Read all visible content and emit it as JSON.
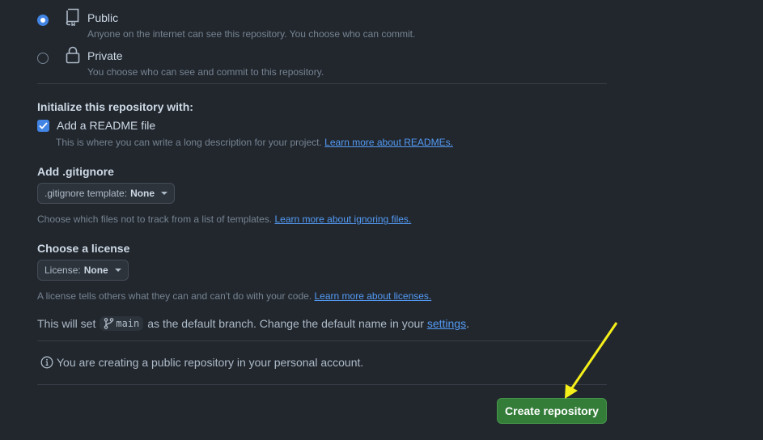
{
  "visibility": {
    "options": [
      {
        "title": "Public",
        "description": "Anyone on the internet can see this repository. You choose who can commit.",
        "icon": "repo-icon",
        "selected": true
      },
      {
        "title": "Private",
        "description": "You choose who can see and commit to this repository.",
        "icon": "lock-icon",
        "selected": false
      }
    ]
  },
  "initialize": {
    "heading": "Initialize this repository with:",
    "readme": {
      "label": "Add a README file",
      "checked": true,
      "note": "This is where you can write a long description for your project.",
      "link": "Learn more about READMEs."
    }
  },
  "gitignore": {
    "heading": "Add .gitignore",
    "select_label": ".gitignore template:",
    "select_value": "None",
    "note": "Choose which files not to track from a list of templates.",
    "link": "Learn more about ignoring files."
  },
  "license": {
    "heading": "Choose a license",
    "select_label": "License:",
    "select_value": "None",
    "note": "A license tells others what they can and can't do with your code.",
    "link": "Learn more about licenses."
  },
  "branch": {
    "prefix": "This will set",
    "name": "main",
    "suffix": "as the default branch. Change the default name in your",
    "link": "settings",
    "end": "."
  },
  "info": {
    "text": "You are creating a public repository in your personal account."
  },
  "create_button": {
    "label": "Create repository"
  },
  "colors": {
    "background": "#22272e",
    "accent_blue": "#4184e4",
    "link_blue": "#539bf5",
    "button_green": "#347d39",
    "annotation_arrow": "#f5f01a"
  }
}
